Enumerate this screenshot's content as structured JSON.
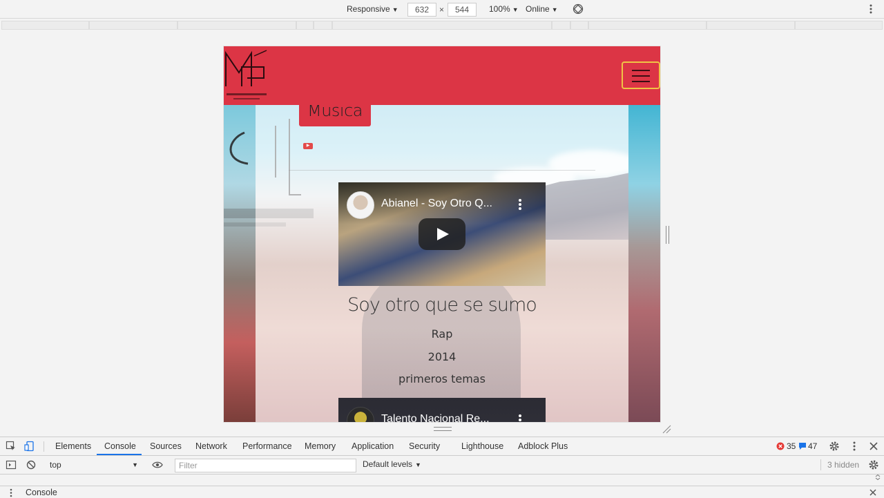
{
  "device_toolbar": {
    "device": "Responsive",
    "width": "632",
    "times": "×",
    "height": "544",
    "zoom": "100%",
    "network": "Online"
  },
  "site": {
    "nav_tab": "Musica",
    "yt_mini": "▶",
    "song": {
      "title": "Soy otro que se sumo",
      "genre": "Rap",
      "year": "2014",
      "album": "primeros temas"
    },
    "videos": [
      {
        "title": "Abianel - Soy Otro Q..."
      },
      {
        "title": "Talento Nacional Re..."
      }
    ],
    "colors": {
      "header": "#dc3545",
      "hamburger_border": "#f0c445"
    }
  },
  "devtools": {
    "tabs": [
      "Elements",
      "Console",
      "Sources",
      "Network",
      "Performance",
      "Memory",
      "Application",
      "Security",
      "Lighthouse",
      "Adblock Plus"
    ],
    "active_tab": "Console",
    "errors": "35",
    "messages": "47",
    "context": "top",
    "filter_placeholder": "Filter",
    "levels": "Default levels",
    "hidden": "3 hidden",
    "drawer_title": "Console"
  }
}
